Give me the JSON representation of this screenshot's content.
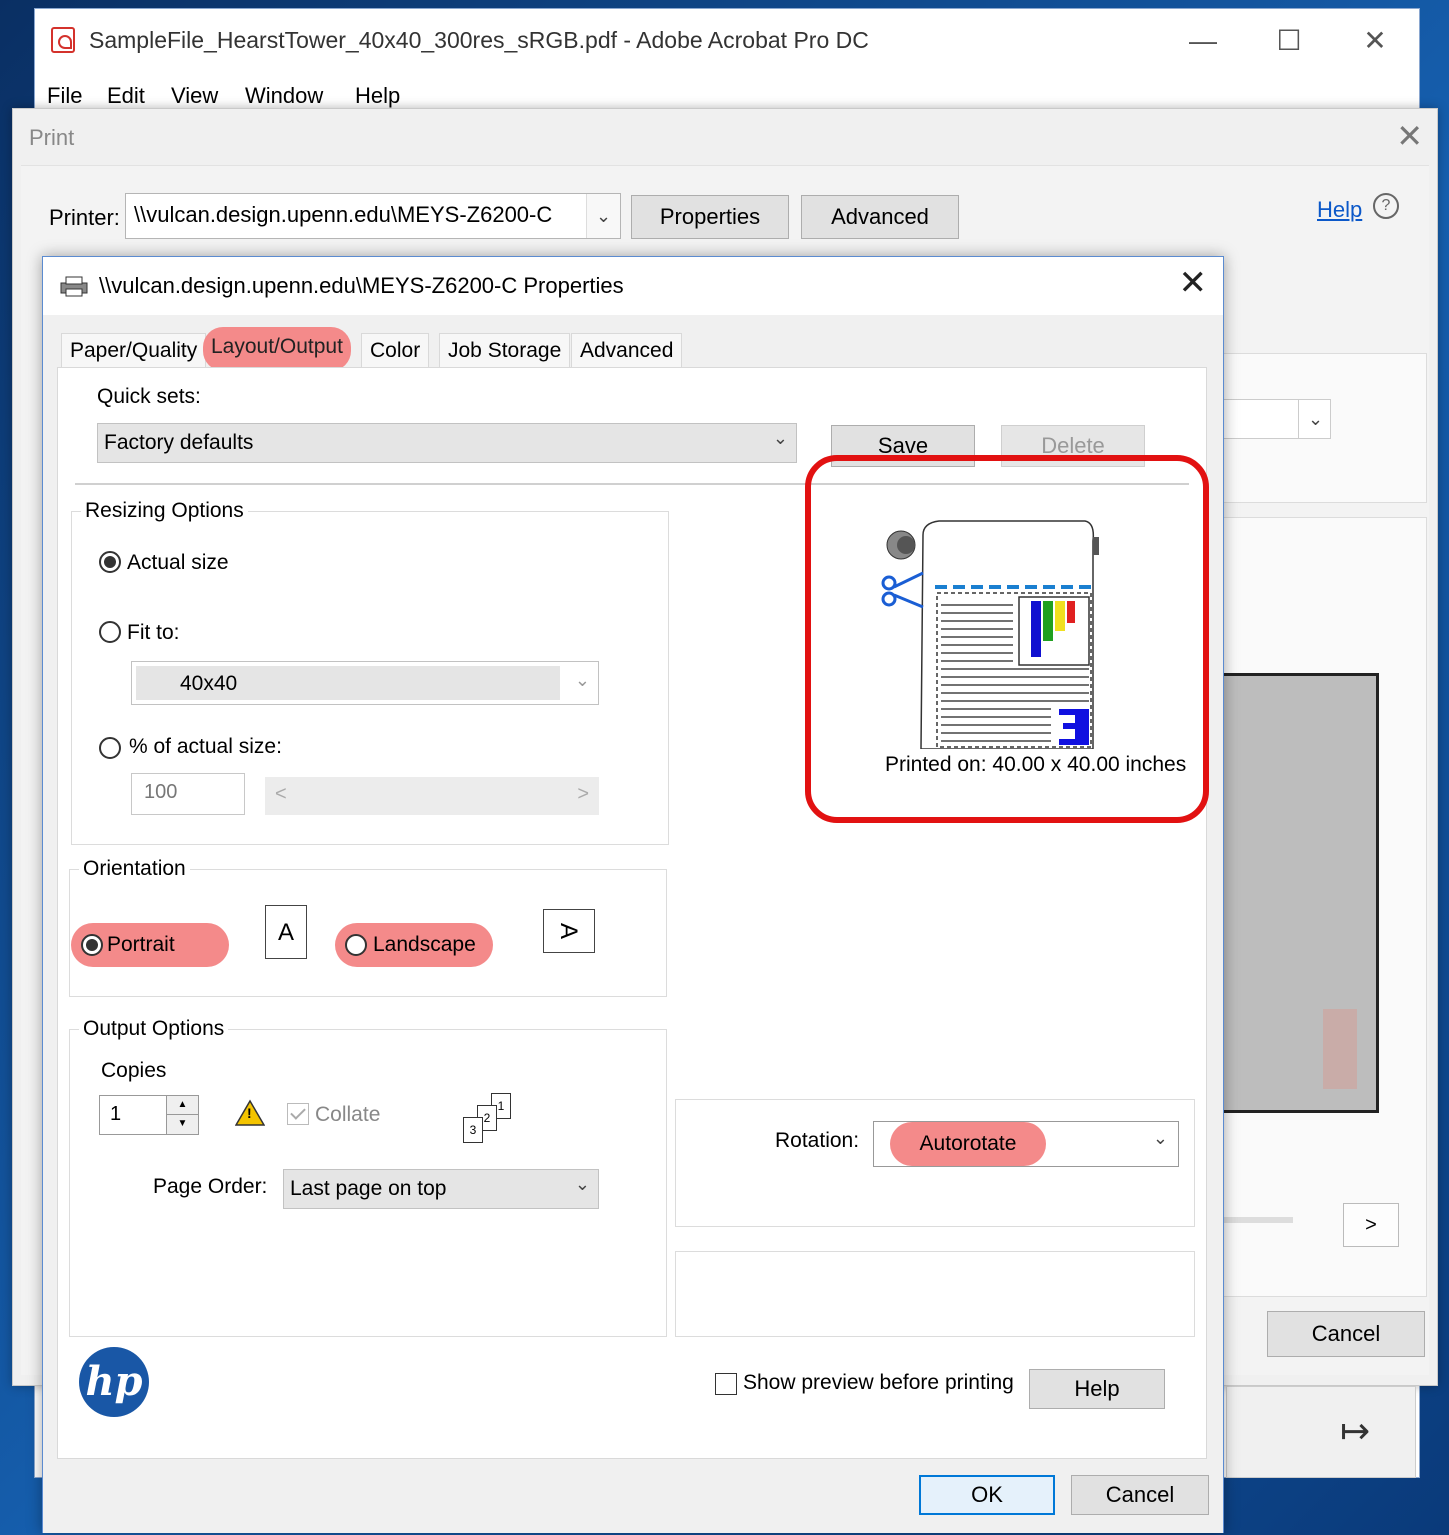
{
  "acrobat": {
    "title": "SampleFile_HearstTower_40x40_300res_sRGB.pdf - Adobe Acrobat Pro DC",
    "menu": [
      "File",
      "Edit",
      "View",
      "Window",
      "Help"
    ]
  },
  "print_dialog": {
    "title": "Print",
    "printer_label": "Printer:",
    "printer_value": "\\\\vulcan.design.upenn.edu\\MEYS-Z6200-C",
    "properties_label": "Properties",
    "advanced_label": "Advanced",
    "help_label": "Help",
    "next_label": ">",
    "cancel_label": "Cancel"
  },
  "props_dialog": {
    "title": "\\\\vulcan.design.upenn.edu\\MEYS-Z6200-C Properties",
    "tabs": [
      "Paper/Quality",
      "Layout/Output",
      "Color",
      "Job Storage",
      "Advanced"
    ],
    "active_tab": "Layout/Output",
    "quick_sets_label": "Quick sets:",
    "quick_sets_value": "Factory defaults",
    "save_label": "Save",
    "delete_label": "Delete",
    "resizing": {
      "title": "Resizing Options",
      "actual_size": "Actual size",
      "fit_to": "Fit to:",
      "fit_to_value": "40x40",
      "percent_label": "% of actual size:",
      "percent_value": "100",
      "scroll_left": "<",
      "scroll_right": ">"
    },
    "preview": {
      "printed_on": "Printed on: 40.00 x 40.00 inches"
    },
    "orientation": {
      "title": "Orientation",
      "portrait": "Portrait",
      "landscape": "Landscape",
      "portrait_glyph": "A",
      "landscape_glyph": "A"
    },
    "output": {
      "title": "Output Options",
      "copies_label": "Copies",
      "copies_value": "1",
      "collate_label": "Collate",
      "page_order_label": "Page Order:",
      "page_order_value": "Last page on top",
      "stack_numbers": [
        "3",
        "2",
        "1"
      ]
    },
    "rotation_label": "Rotation:",
    "rotation_value": "Autorotate",
    "show_preview_label": "Show preview before printing",
    "help_label": "Help",
    "ok_label": "OK",
    "cancel_label": "Cancel",
    "hp_logo": "hp",
    "warning_glyph": "!"
  }
}
